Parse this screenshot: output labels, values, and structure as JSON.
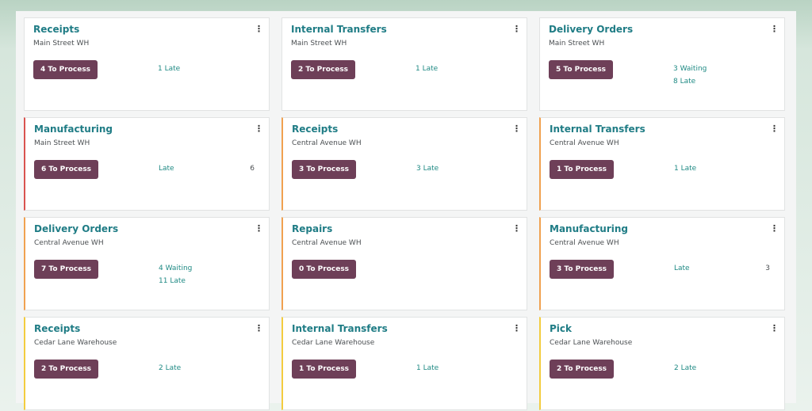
{
  "colors": {
    "accent_teal": "#1f7c85",
    "button_purple": "#6e3f58",
    "late_red": "#d9534f",
    "warn_orange": "#f0a150",
    "warn_yellow": "#f3cc3f"
  },
  "icons": {
    "card_menu": "kebab-vertical-icon"
  },
  "cards": [
    {
      "title": "Receipts",
      "warehouse": "Main Street WH",
      "process_label": "4 To Process",
      "stats": [
        "1 Late"
      ],
      "count": ""
    },
    {
      "title": "Internal Transfers",
      "warehouse": "Main Street WH",
      "process_label": "2 To Process",
      "stats": [
        "1 Late"
      ],
      "count": ""
    },
    {
      "title": "Delivery Orders",
      "warehouse": "Main Street WH",
      "process_label": "5 To Process",
      "stats": [
        "3 Waiting",
        "8 Late"
      ],
      "count": ""
    },
    {
      "title": "Manufacturing",
      "warehouse": "Main Street WH",
      "process_label": "6 To Process",
      "stats": [
        "Late"
      ],
      "count": "6"
    },
    {
      "title": "Receipts",
      "warehouse": "Central Avenue WH",
      "process_label": "3 To Process",
      "stats": [
        "3 Late"
      ],
      "count": ""
    },
    {
      "title": "Internal Transfers",
      "warehouse": "Central Avenue WH",
      "process_label": "1 To Process",
      "stats": [
        "1 Late"
      ],
      "count": ""
    },
    {
      "title": "Delivery Orders",
      "warehouse": "Central Avenue WH",
      "process_label": "7 To Process",
      "stats": [
        "4 Waiting",
        "11 Late"
      ],
      "count": ""
    },
    {
      "title": "Repairs",
      "warehouse": "Central Avenue WH",
      "process_label": "0 To Process",
      "stats": [],
      "count": ""
    },
    {
      "title": "Manufacturing",
      "warehouse": "Central Avenue WH",
      "process_label": "3 To Process",
      "stats": [
        "Late"
      ],
      "count": "3"
    },
    {
      "title": "Receipts",
      "warehouse": "Cedar Lane Warehouse",
      "process_label": "2 To Process",
      "stats": [
        "2 Late"
      ],
      "count": ""
    },
    {
      "title": "Internal Transfers",
      "warehouse": "Cedar Lane Warehouse",
      "process_label": "1 To Process",
      "stats": [
        "1 Late"
      ],
      "count": ""
    },
    {
      "title": "Pick",
      "warehouse": "Cedar Lane Warehouse",
      "process_label": "2 To Process",
      "stats": [
        "2 Late"
      ],
      "count": ""
    }
  ]
}
